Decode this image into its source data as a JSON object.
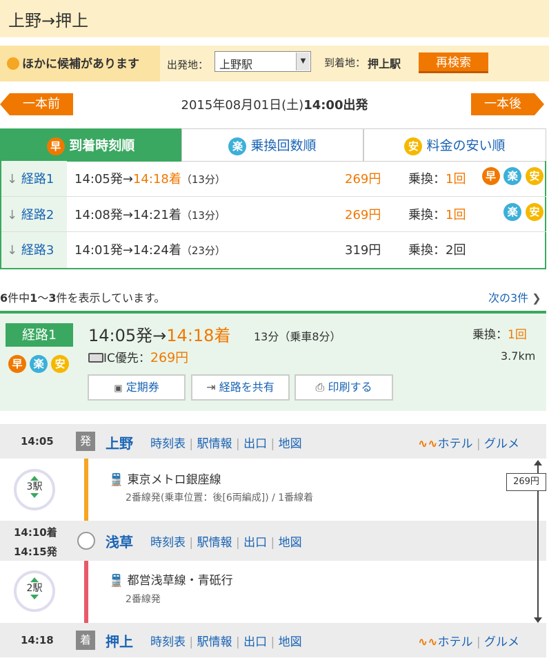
{
  "header": {
    "title": "上野→押上"
  },
  "conditions": {
    "alt_notice": "ほかに候補があります",
    "from_label": "出発地：",
    "from_value": "上野駅",
    "to_label": "到着地：",
    "to_value": "押上駅",
    "research_label": "再検索"
  },
  "nav": {
    "prev_label": "一本前",
    "next_label": "一本後",
    "date_text": "2015年08月01日(土)",
    "time_text": "14:00出発"
  },
  "tabs": [
    {
      "icon": "早",
      "label": "到着時刻順"
    },
    {
      "icon": "楽",
      "label": "乗換回数順"
    },
    {
      "icon": "安",
      "label": "料金の安い順"
    }
  ],
  "routes": [
    {
      "label": "経路1",
      "dep": "14:05発→",
      "arr": "14:18着",
      "dur": "（13分）",
      "fare": "269円",
      "xfer_label": "乗換：",
      "xfer": "1回",
      "icons": [
        "早",
        "楽",
        "安"
      ]
    },
    {
      "label": "経路2",
      "dep": "14:08発→",
      "arr": "14:21着",
      "dur": "（13分）",
      "fare": "269円",
      "xfer_label": "乗換：",
      "xfer": "1回",
      "icons": [
        "楽",
        "安"
      ]
    },
    {
      "label": "経路3",
      "dep": "14:01発→",
      "arr": "14:24着",
      "dur": "（23分）",
      "fare": "319円",
      "xfer_label": "乗換：",
      "xfer": "2回",
      "icons": []
    }
  ],
  "result_count": {
    "total": "6",
    "mid1": "件中",
    "range_a": "1",
    "tilde": "～",
    "range_b": "3",
    "suffix": "件を表示しています。"
  },
  "next_results": "次の3件",
  "detail": {
    "badge": "経路1",
    "dep": "14:05発→",
    "arr": "14:18着",
    "dur": "13分（乗車8分）",
    "xfer_label": "乗換：",
    "xfer": "1回",
    "ic_label": "IC優先：",
    "fare": "269円",
    "distance": "3.7km",
    "buttons": [
      "定期券",
      "経路を共有",
      "印刷する"
    ]
  },
  "stations": [
    {
      "time": "14:05",
      "mark": "発",
      "name": "上野",
      "links": [
        "時刻表",
        "駅情報",
        "出口",
        "地図"
      ],
      "extra": [
        "ホテル",
        "グルメ"
      ]
    },
    {
      "time_arr": "14:10着",
      "time_dep": "14:15発",
      "name": "浅草",
      "links": [
        "時刻表",
        "駅情報",
        "出口",
        "地図"
      ]
    },
    {
      "time": "14:18",
      "mark": "着",
      "name": "押上",
      "links": [
        "時刻表",
        "駅情報",
        "出口",
        "地図"
      ],
      "extra": [
        "ホテル",
        "グルメ"
      ]
    }
  ],
  "segments": [
    {
      "stops": "3駅",
      "line": "東京メトロ銀座線",
      "sub": "2番線発(乗車位置：後[6両編成]) / 1番線着",
      "color": "#f5a623"
    },
    {
      "stops": "2駅",
      "line": "都営浅草線・青砥行",
      "sub": "2番線発",
      "color": "#e85a6a"
    }
  ],
  "fare_marker": "269円",
  "colors": {
    "accent": "#f07800",
    "green": "#3aa860",
    "link": "#1a64b4"
  }
}
